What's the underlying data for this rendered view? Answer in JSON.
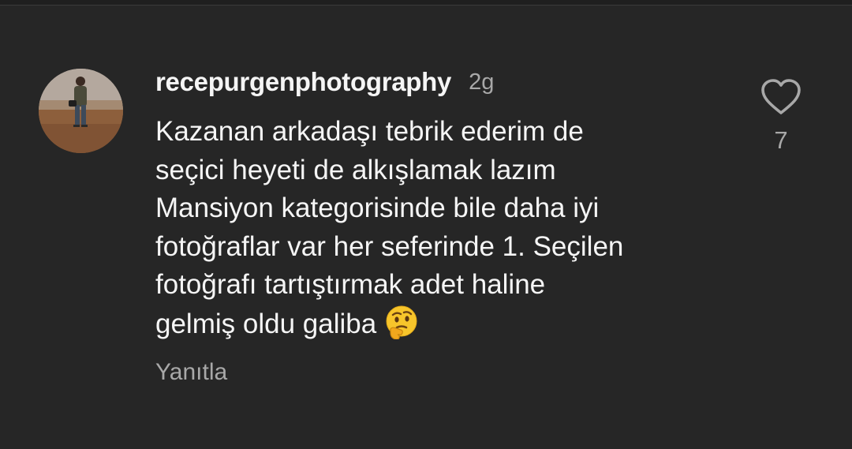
{
  "comment": {
    "username": "recepurgenphotography",
    "time_ago": "2g",
    "text_lines": [
      "Kazanan arkadaşı tebrik ederim de",
      "seçici heyeti de alkışlamak lazım",
      "Mansiyon kategorisinde bile daha iyi",
      "fotoğraflar var her seferinde 1. Seçilen",
      "fotoğrafı tartıştırmak adet haline",
      "gelmiş oldu galiba"
    ],
    "emoji": "🤔",
    "reply_label": "Yanıtla",
    "like_count": "7"
  },
  "colors": {
    "background": "#262626",
    "primary_text": "#f5f5f5",
    "secondary_text": "#a8a8a8"
  },
  "icons": {
    "like": "heart-outline-icon",
    "emoji": "thinking-face-emoji"
  }
}
